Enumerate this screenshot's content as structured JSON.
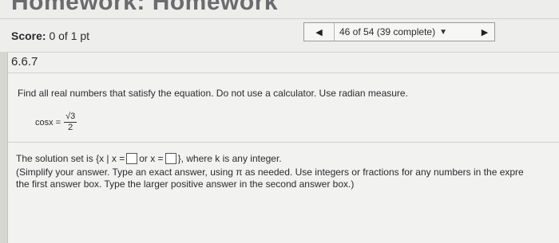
{
  "header": {
    "title": "Homework: Homework"
  },
  "score": {
    "label": "Score:",
    "value": "0 of 1 pt"
  },
  "nav": {
    "prev_icon": "triangle-left",
    "position": "46 of 54 (39 complete)",
    "dropdown_icon": "triangle-down",
    "next_icon": "triangle-right"
  },
  "section": {
    "number": "6.6.7"
  },
  "problem": {
    "instruction": "Find all real numbers that satisfy the equation. Do not use a calculator. Use radian measure.",
    "equation_lhs": "cosx =",
    "numerator": "√3",
    "denominator": "2"
  },
  "solution": {
    "prefix": "The solution set is",
    "open": "{x | x =",
    "or": "or x =",
    "close": "}",
    "suffix": ", where k is any integer."
  },
  "hint": {
    "line1": "(Simplify your answer. Type an exact answer, using π as needed. Use integers or fractions for any numbers in the expre",
    "line2": "the first answer box. Type the larger positive answer in the second answer box.)"
  }
}
